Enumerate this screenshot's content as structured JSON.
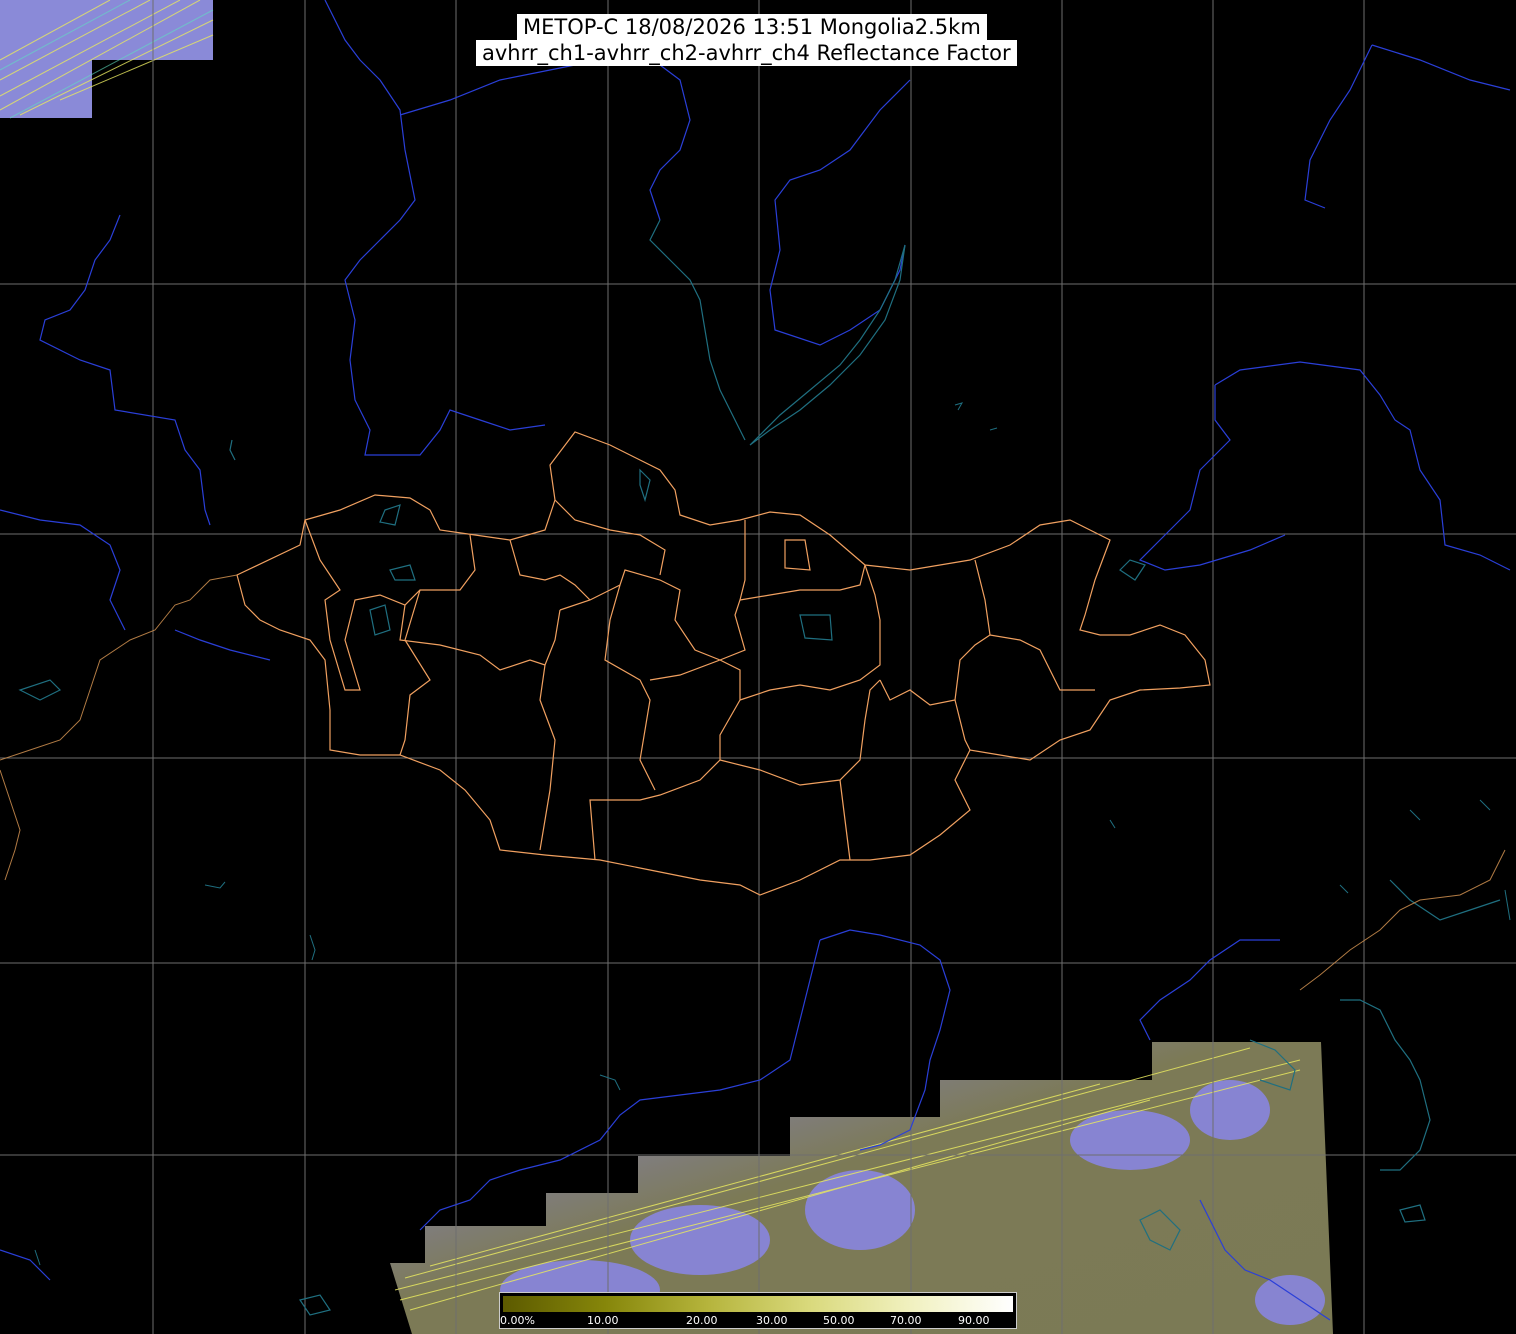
{
  "title": {
    "line1": "METOP-C 18/08/2026 13:51 Mongolia2.5km",
    "line2": "avhrr_ch1-avhrr_ch2-avhrr_ch4 Reflectance Factor"
  },
  "legend": {
    "ticks": [
      "0.00%",
      "10.00",
      "20.00",
      "30.00",
      "50.00",
      "70.00",
      "90.00"
    ]
  },
  "colors": {
    "background": "#000000",
    "graticule": "#6e6e6e",
    "rivers": "#2a3fd8",
    "coastlines": "#1f6f80",
    "admin_boundaries": "#f0a060",
    "swath_land": "#7c7a56",
    "swath_cloud": "#8a86e8"
  }
}
